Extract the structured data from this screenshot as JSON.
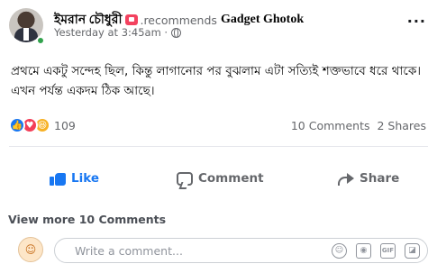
{
  "post": {
    "author": "ইমরান চৌধুরী",
    "recommends_text": ".recommends",
    "page_name": "Gadget Ghotok",
    "timestamp": "Yesterday at 3:45am ·",
    "more_icon": "...",
    "text": "প্রথমে একটু সন্দেহ ছিল, কিন্তু লাগানোর পর বুঝলাম এটা সত্যিই শক্তভাবে ধরে থাকে। এখন পর্যন্ত একদম ঠিক আছে।"
  },
  "stats": {
    "reaction_count": "109",
    "comments": "10 Comments",
    "shares": "2 Shares"
  },
  "actions": {
    "like_label": "Like",
    "comment_label": "Comment",
    "share_label": "Share"
  },
  "comments": {
    "view_more": "View more 10 Comments",
    "placeholder": "Write a comment..."
  },
  "colors": {
    "accent": "#1877f2",
    "muted": "#65676b",
    "love": "#f33e58",
    "haha": "#f7b125",
    "online": "#31a24c"
  },
  "icons": {
    "react_like": "👍",
    "react_love": "♥",
    "react_haha": "😆",
    "emoji": "☺",
    "camera": "◉",
    "gif": "GIF",
    "sticker": "◪",
    "my_avatar": "☺"
  }
}
